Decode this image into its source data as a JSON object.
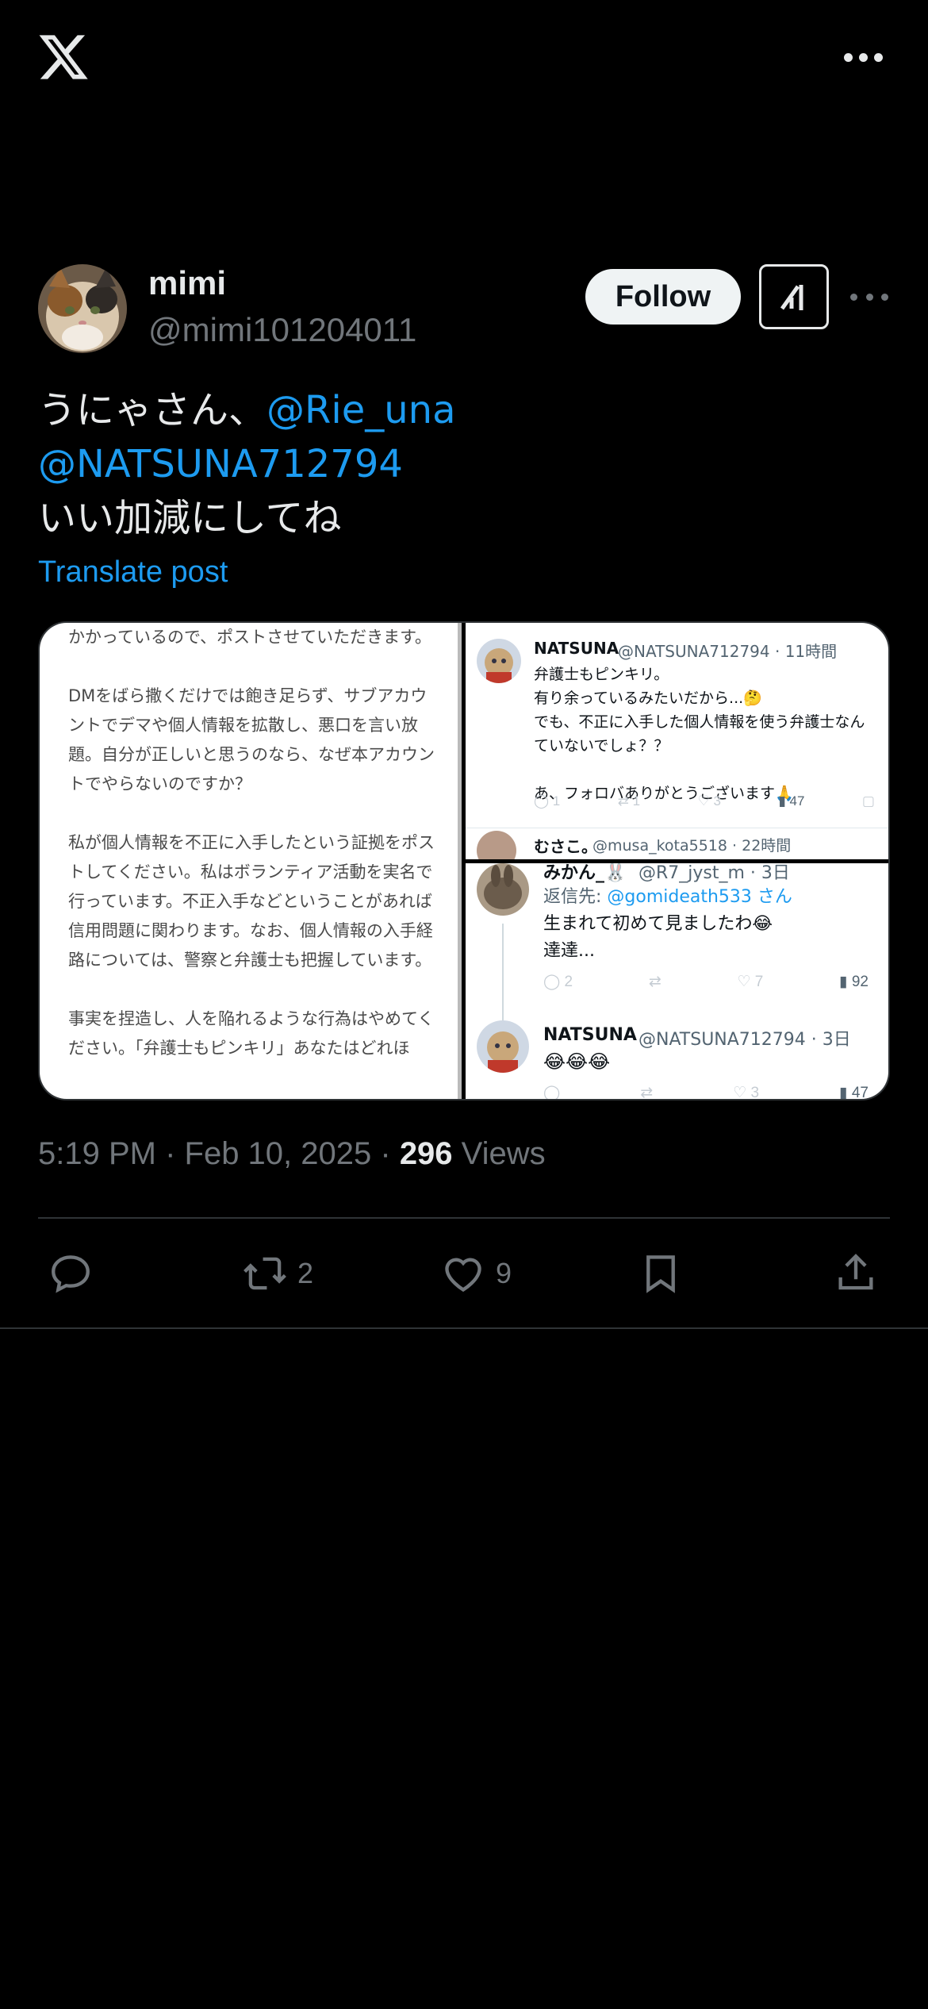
{
  "topbar": {
    "logo_icon": "x-logo-icon",
    "more_icon": "more-dots-icon"
  },
  "author": {
    "name": "mimi",
    "handle": "@mimi101204011",
    "follow_label": "Follow",
    "grok_icon": "grok-icon"
  },
  "tweet": {
    "line1_text": "うにゃさん、",
    "mention1": "@Rie_una",
    "mention2": "@NATSUNA712794",
    "line3_text": "いい加減にしてね",
    "translate_label": "Translate post"
  },
  "media": {
    "left_paragraphs": [
      "かかっているので、ポストさせていただきます。",
      "DMをばら撒くだけでは飽き足らず、サブアカウントでデマや個人情報を拡散し、悪口を言い放題。自分が正しいと思うのなら、なぜ本アカウントでやらないのですか？",
      "私が個人情報を不正に入手したという証拠をポストしてください。私はボランティア活動を実名で行っています。不正入手などということがあれば信用問題に関わります。なお、個人情報の入手経路については、警察と弁護士も把握しています。",
      "事実を捏造し、人を陥れるような行為はやめてください。「弁護士もピンキリ」あなたはどれほ"
    ],
    "right_top": {
      "name": "NATSUNA",
      "handle_time": "@NATSUNA712794 · 11時間",
      "lines": [
        "弁護士もピンキリ。",
        "有り余っているみたいだから...🤔",
        "でも、不正に入手した個人情報を使う弁護士なんていないでしょ？？",
        "",
        "あ、フォロバありがとうございます🙏"
      ],
      "stats": [
        "1",
        "1",
        "3",
        "47"
      ],
      "next_name": "むさこ。",
      "next_handle": "@musa_kota5518 · 22時間"
    },
    "right_bottom": {
      "name_top": "みかん_🐰",
      "handle_top": "@R7_jyst_m · 3日",
      "reply_to_prefix": "返信先: ",
      "reply_to_handle": "@gomideath533 さん",
      "lines": [
        "生まれて初めて見ましたわ😂",
        "達達..."
      ],
      "stats": [
        "2",
        "",
        "7",
        "92"
      ],
      "name2": "NATSUNA",
      "handle2": "@NATSUNA712794 · 3日",
      "line2": "😂😂😂",
      "stats2": [
        "",
        "",
        "3",
        "47"
      ]
    }
  },
  "meta": {
    "time": "5:19 PM · Feb 10, 2025 · ",
    "views_count": "296",
    "views_label": " Views"
  },
  "actions": {
    "reply_icon": "reply-icon",
    "retweet_icon": "retweet-icon",
    "retweet_count": "2",
    "like_icon": "heart-icon",
    "like_count": "9",
    "bookmark_icon": "bookmark-icon",
    "share_icon": "share-icon"
  },
  "colors": {
    "accent": "#1d9bf0",
    "background": "#000000",
    "text": "#e7e9ea",
    "muted": "#71767b"
  }
}
